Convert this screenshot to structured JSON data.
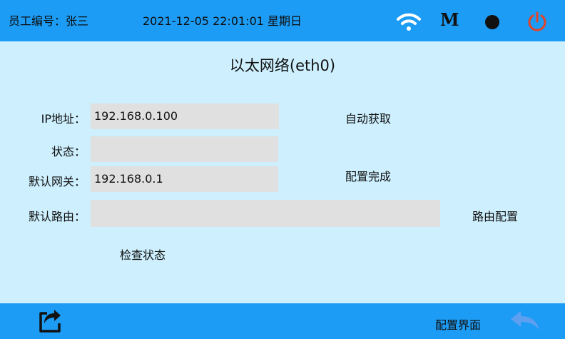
{
  "header": {
    "employee_id": "员工编号：张三",
    "datetime": "2021-12-05 22:01:01 星期日",
    "m_label": "M"
  },
  "page": {
    "title": "以太网络(eth0)"
  },
  "form": {
    "ip_label": "IP地址：",
    "ip_value": "192.168.0.100",
    "status_label": "状态：",
    "status_value": "",
    "gateway_label": "默认网关：",
    "gateway_value": "192.168.0.1",
    "route_label": "默认路由：",
    "route_value": ""
  },
  "actions": {
    "auto_obtain": "自动获取",
    "config_done": "配置完成",
    "route_config": "路由配置",
    "check_status": "检查状态"
  },
  "footer": {
    "config_page": "配置界面"
  },
  "colors": {
    "bar": "#1c9cf5",
    "background": "#cdeffe",
    "field": "#e0e0e0",
    "power": "#e0442a"
  },
  "icons": [
    "wifi-icon",
    "m-icon",
    "record-dot-icon",
    "power-icon",
    "return-icon",
    "back-arrow-icon"
  ]
}
